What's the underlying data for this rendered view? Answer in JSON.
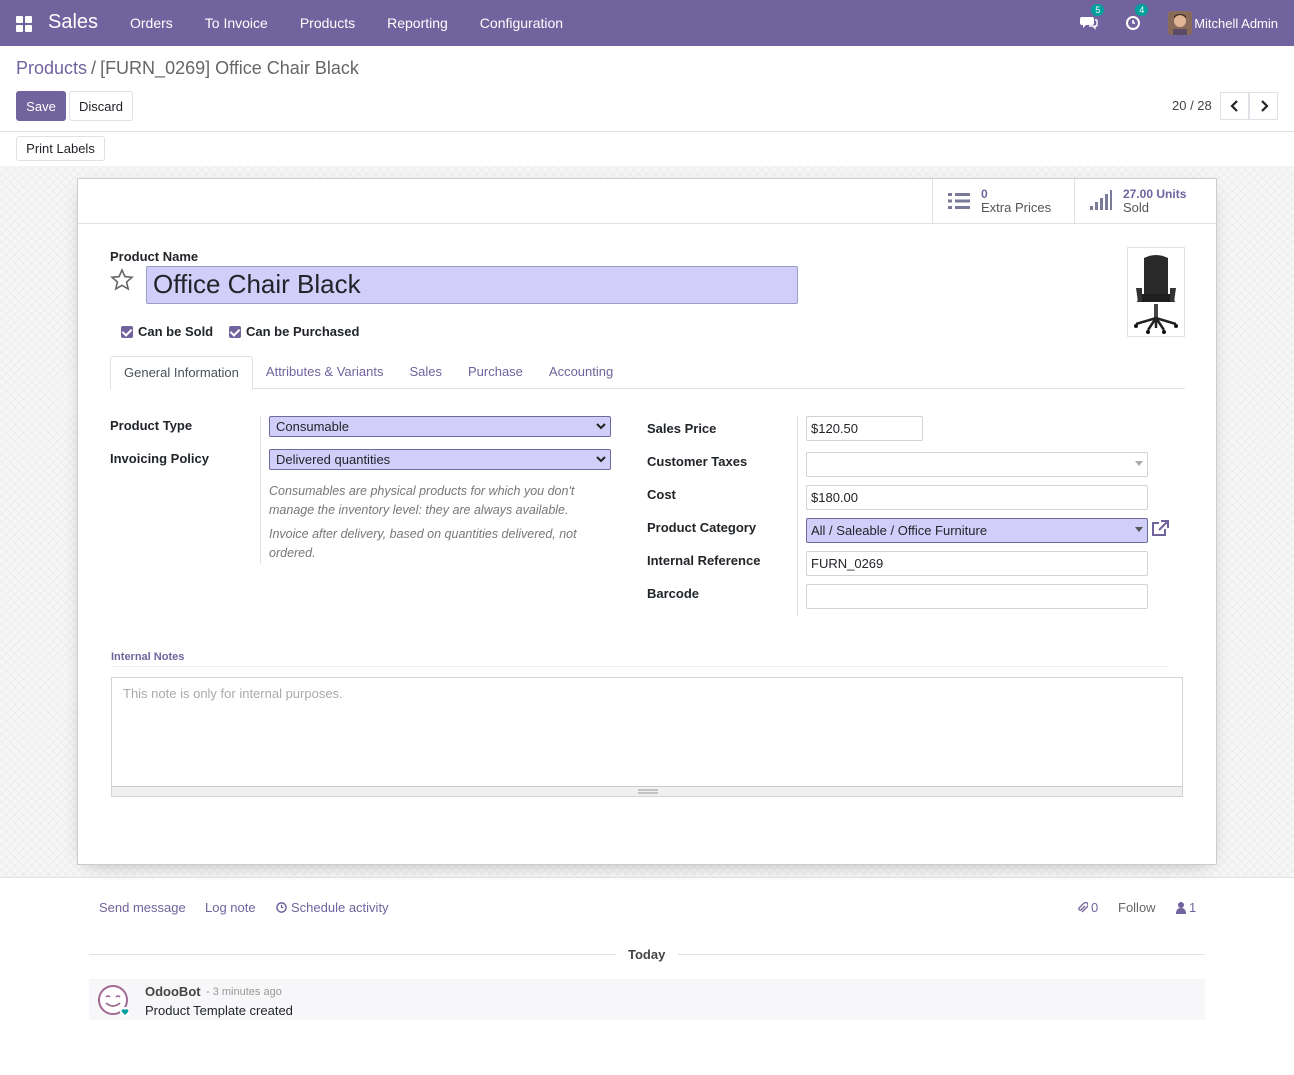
{
  "navbar": {
    "app_name": "Sales",
    "menu": [
      "Orders",
      "To Invoice",
      "Products",
      "Reporting",
      "Configuration"
    ],
    "messages_count": "5",
    "activities_count": "4",
    "user_name": "Mitchell Admin",
    "color": "#71639e"
  },
  "breadcrumb": {
    "parent": "Products",
    "separator": "/",
    "current": "[FURN_0269] Office Chair Black"
  },
  "actions": {
    "save": "Save",
    "discard": "Discard",
    "print_labels": "Print Labels"
  },
  "pager": {
    "value": "20 / 28"
  },
  "smart_buttons": {
    "extra_prices": {
      "value": "0",
      "label": "Extra Prices",
      "icon": "list-icon"
    },
    "sold": {
      "value": "27.00 Units",
      "label": "Sold",
      "icon": "signal-icon"
    }
  },
  "product": {
    "name_label": "Product Name",
    "name": "Office Chair Black",
    "can_be_sold_label": "Can be Sold",
    "can_be_purchased_label": "Can be Purchased",
    "can_be_sold": true,
    "can_be_purchased": true
  },
  "tabs": [
    "General Information",
    "Attributes & Variants",
    "Sales",
    "Purchase",
    "Accounting"
  ],
  "general": {
    "product_type_label": "Product Type",
    "product_type": "Consumable",
    "invoicing_policy_label": "Invoicing Policy",
    "invoicing_policy": "Delivered quantities",
    "help_consumable": "Consumables are physical products for which you don't manage the inventory level: they are always available.",
    "help_invoice": "Invoice after delivery, based on quantities delivered, not ordered.",
    "sales_price_label": "Sales Price",
    "sales_price": "$120.50",
    "customer_taxes_label": "Customer Taxes",
    "customer_taxes": "",
    "cost_label": "Cost",
    "cost": "$180.00",
    "product_category_label": "Product Category",
    "product_category": "All / Saleable / Office Furniture",
    "internal_reference_label": "Internal Reference",
    "internal_reference": "FURN_0269",
    "barcode_label": "Barcode",
    "barcode": ""
  },
  "notes": {
    "title": "Internal Notes",
    "placeholder": "This note is only for internal purposes."
  },
  "chatter": {
    "send_message": "Send message",
    "log_note": "Log note",
    "schedule_activity": "Schedule activity",
    "attachments": "0",
    "follow": "Follow",
    "followers": "1",
    "date_separator": "Today",
    "messages": [
      {
        "author": "OdooBot",
        "time": "- 3 minutes ago",
        "body": "Product Template created"
      }
    ]
  }
}
